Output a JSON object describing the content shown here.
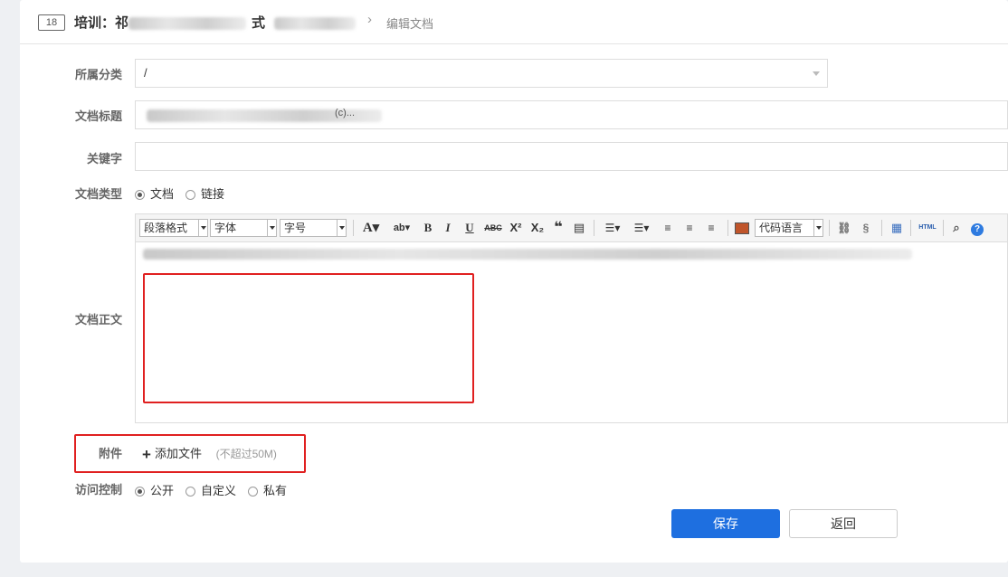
{
  "header": {
    "doc_count": "18",
    "title_prefix": "培训：",
    "title_hint_char": "祁",
    "title_hint_char2": "式",
    "separator": "›",
    "current": "编辑文档"
  },
  "form": {
    "category": {
      "label": "所属分类",
      "value": "/"
    },
    "title": {
      "label": "文档标题",
      "value_hint": "(c)..."
    },
    "keywords": {
      "label": "关键字",
      "value": ""
    },
    "doc_type": {
      "label": "文档类型",
      "options": [
        "文档",
        "链接"
      ],
      "selected": "文档"
    },
    "body": {
      "label": "文档正文"
    },
    "attachment": {
      "label": "附件",
      "add_label": "添加文件",
      "limit_hint": "(不超过50M)"
    },
    "access": {
      "label": "访问控制",
      "options": [
        "公开",
        "自定义",
        "私有"
      ],
      "selected": "公开"
    }
  },
  "toolbar": {
    "paragraph": "段落格式",
    "font": "字体",
    "size": "字号",
    "code_lang": "代码语言",
    "html": "HTML"
  },
  "actions": {
    "save": "保存",
    "back": "返回"
  },
  "colors": {
    "primary": "#1e6fe0",
    "highlight": "#e02020"
  }
}
